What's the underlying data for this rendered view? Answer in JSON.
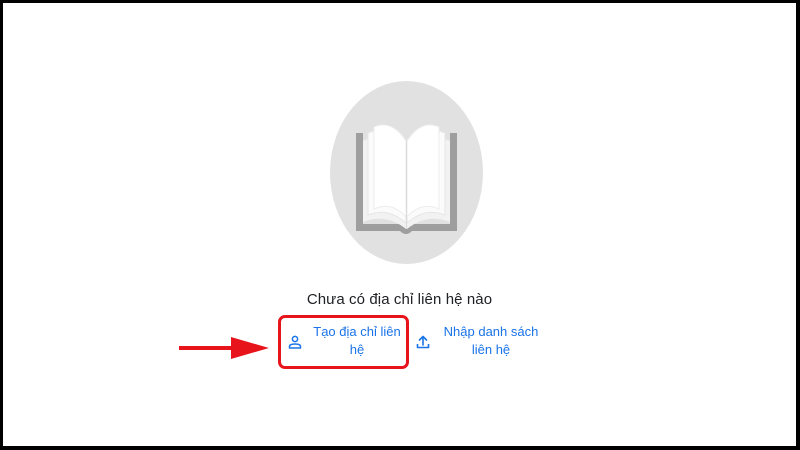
{
  "empty_state": {
    "message": "Chưa có địa chỉ liên hệ nào",
    "illustration_icon": "open-book-icon"
  },
  "actions": {
    "create": {
      "label": "Tạo địa chỉ liên hệ",
      "icon": "person-icon"
    },
    "import": {
      "label": "Nhập danh sách liên hệ",
      "icon": "upload-icon"
    }
  },
  "annotation": {
    "arrow_icon": "arrow-right-icon",
    "color": "#e8141c"
  },
  "colors": {
    "link": "#1a73e8",
    "text": "#202124",
    "illustration_bg": "#e1e1e1"
  }
}
